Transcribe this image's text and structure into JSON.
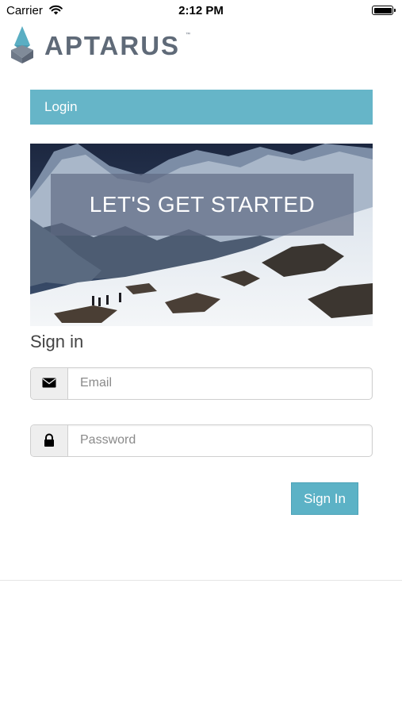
{
  "status_bar": {
    "carrier": "Carrier",
    "time": "2:12 PM",
    "battery_level": 1.0
  },
  "logo": {
    "text": "APTARUS",
    "trademark": "™",
    "icon": "aptarus-logo-mark",
    "color": "#5f6a78",
    "accent_color": "#5aaec3"
  },
  "login_bar": {
    "label": "Login",
    "color": "#66b5c8"
  },
  "hero": {
    "banner_text": "LET'S GET STARTED",
    "image": "snowy-mountain-hikers-photo"
  },
  "sign_in": {
    "title": "Sign in",
    "email": {
      "icon": "envelope-icon",
      "placeholder": "Email",
      "value": ""
    },
    "password": {
      "icon": "lock-icon",
      "placeholder": "Password",
      "value": ""
    },
    "button_label": "Sign In",
    "button_color": "#5cb2c6"
  }
}
